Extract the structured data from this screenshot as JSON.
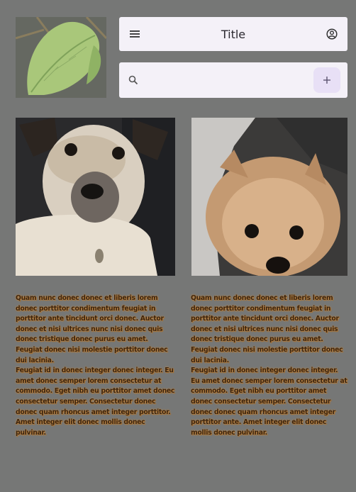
{
  "appbar": {
    "title": "Title",
    "menu_icon": "menu-icon",
    "account_icon": "account-circle-icon"
  },
  "search": {
    "value": "",
    "placeholder": "",
    "search_icon": "search-icon",
    "add_icon": "plus-icon"
  },
  "images": {
    "thumbnail": "leaf",
    "left_photo": "dog",
    "right_photo": "pomeranian"
  },
  "columns": {
    "left": {
      "p1": "Quam nunc donec donec et liberis lorem donec porttitor condimentum feugiat in porttitor ante tincidunt orci donec. Auctor donec et nisi ultrices nunc nisi donec quis donec tristique donec purus eu amet. Feugiat donec nisi molestie porttitor donec dui lacinia.",
      "p2": "Feugiat id in donec integer donec integer. Eu amet donec semper lorem consectetur at commodo. Eget nibh eu porttitor amet donec consectetur semper. Consectetur donec donec quam rhoncus amet integer porttitor. Amet integer elit donec mollis donec pulvinar."
    },
    "right": {
      "p1": "Quam nunc donec donec et liberis lorem donec porttitor condimentum feugiat in porttitor ante tincidunt orci donec. Auctor donec et nisi ultrices nunc nisi donec quis donec tristique donec purus eu amet. Feugiat donec nisi molestie porttitor donec dui lacinia.",
      "p2": "Feugiat id in donec integer donec integer. Eu amet donec semper lorem consectetur at commodo. Eget nibh eu porttitor amet donec consectetur semper. Consectetur donec donec quam rhoncus amet integer porttitor ante. Amet integer elit donec mollis donec pulvinar."
    }
  },
  "colors": {
    "background": "#767776",
    "surface": "#f4f1f8",
    "add_button": "#e8e0f6"
  }
}
